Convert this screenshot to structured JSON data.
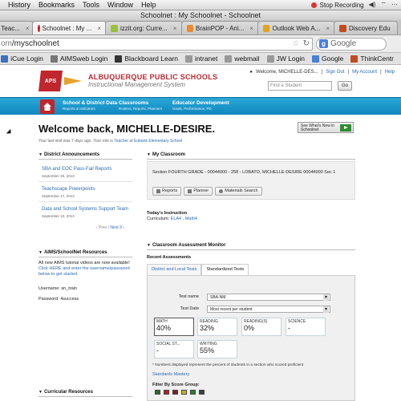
{
  "menubar": {
    "items": [
      "History",
      "Bookmarks",
      "Tools",
      "Window",
      "Help"
    ],
    "recording": "Stop Recording"
  },
  "window": {
    "title": "Schoolnet : My Schoolnet - Schoolnet"
  },
  "tabs": [
    {
      "label": ": Teac...",
      "color": "#888888",
      "active": false
    },
    {
      "label": "Schoolnet : My ...",
      "color": "#c0262d",
      "active": true
    },
    {
      "label": "izzit.org: Curre...",
      "color": "#9ac13a",
      "active": false
    },
    {
      "label": "BrainPOP - Ani...",
      "color": "#e98b2c",
      "active": false
    },
    {
      "label": "Outlook Web A...",
      "color": "#e3a31b",
      "active": false
    },
    {
      "label": "Discovery Edu",
      "color": "#c24a1e",
      "active": false
    }
  ],
  "address": {
    "host": "om",
    "path": "/myschoolnet",
    "search_placeholder": "Google"
  },
  "bookmarks": [
    {
      "label": "iCue Login",
      "color": "#3c70c2"
    },
    {
      "label": "AIMSweb Login",
      "color": "#777777"
    },
    {
      "label": "Blackboard Learn",
      "color": "#333333"
    },
    {
      "label": "intranet",
      "color": "#999999"
    },
    {
      "label": "webmail",
      "color": "#999999"
    },
    {
      "label": "JW Login",
      "color": "#999999"
    },
    {
      "label": "Google",
      "color": "#4a7fd8"
    },
    {
      "label": "ThinkCentr",
      "color": "#c24a1e"
    }
  ],
  "site": {
    "logo_text": "APS",
    "school_line1": "ALBUQUERQUE PUBLIC SCHOOLS",
    "school_line2": "Instructional Management System",
    "welcome_user": "Welcome, MICHELLE-DES...",
    "sign_out": "Sign Out",
    "my_account": "My Account",
    "help": "Help",
    "find_placeholder": "Find a Student",
    "go": "Go"
  },
  "nav": [
    {
      "title": "School & District Data",
      "sub": "Reports & Indicators"
    },
    {
      "title": "Classrooms",
      "sub": "Rosters, Reports, Planners"
    },
    {
      "title": "Educator Development",
      "sub": "Goals, Performance, PD"
    }
  ],
  "welcome": {
    "heading": "Welcome back, MICHELLE-DESIRE.",
    "last_visit_pre": "Your last visit was 7 days ago. Your role is ",
    "role": "Teacher",
    "at": " at ",
    "school": "Eubank Elementary School",
    "whats_new": "See What's New in Schoolnet"
  },
  "announcements": {
    "header": "District Announcements",
    "items": [
      {
        "title": "SBA and EOC Pass-Fail Reports",
        "date": "September 25, 2013"
      },
      {
        "title": "Teachscape Powerpoints",
        "date": "September 17, 2013"
      },
      {
        "title": "Data and School Systems Support Team",
        "date": "September 10, 2013"
      }
    ],
    "prev": "‹ Prev",
    "next": "Next 3 ›"
  },
  "aims": {
    "header": "AIMS/SchoolNet Resources",
    "text_pre": "All new AIMS tutorial videos are now available! ",
    "link": "Click HERE and enter the username/password below to get started.",
    "username": "Username: sn_train",
    "password": "Password: 4success"
  },
  "curricular": {
    "header": "Curricular Resources"
  },
  "classroom": {
    "header": "My Classroom",
    "section": "Section   FOURTH GRADE - 00044000 - 258 - LOBATO, MICHELLE-DESIRE 00044000 Sec 1",
    "buttons": [
      "Reports",
      "Planner",
      "Materials Search"
    ],
    "today_label": "Today's Instruction",
    "curriculum_pre": "Curriculum: ",
    "curriculum_items": "ELA4 , Math4"
  },
  "assessment": {
    "header": "Classroom Assessment Monitor",
    "recent": "Recent Assessments",
    "tabs": [
      "District and Local Tests",
      "Standardized Tests"
    ],
    "test_name_label": "Test name",
    "test_name": "SBA-NM",
    "test_date_label": "Test Date",
    "test_date": "Most recent per student",
    "scores": [
      {
        "label": "MATH",
        "value": "40%",
        "selected": true
      },
      {
        "label": "READING",
        "value": "32%",
        "selected": false
      },
      {
        "label": "READING(S)",
        "value": "0%",
        "selected": false
      },
      {
        "label": "SCIENCE",
        "value": "-",
        "selected": false
      },
      {
        "label": "SOCIAL ST...",
        "value": "-",
        "selected": false
      },
      {
        "label": "WRITING",
        "value": "55%",
        "selected": false
      }
    ],
    "note": "* Numbers displayed represent the percent of students in a section who scored proficient",
    "standards_mastery": "Standards Mastery",
    "filter_label": "Filter By Score Group:",
    "swatch_colors": [
      "#2f6b2f",
      "#b8201f",
      "#7a1f1f",
      "#c6b224",
      "#2e7d2e",
      "#3d3d3d"
    ]
  }
}
